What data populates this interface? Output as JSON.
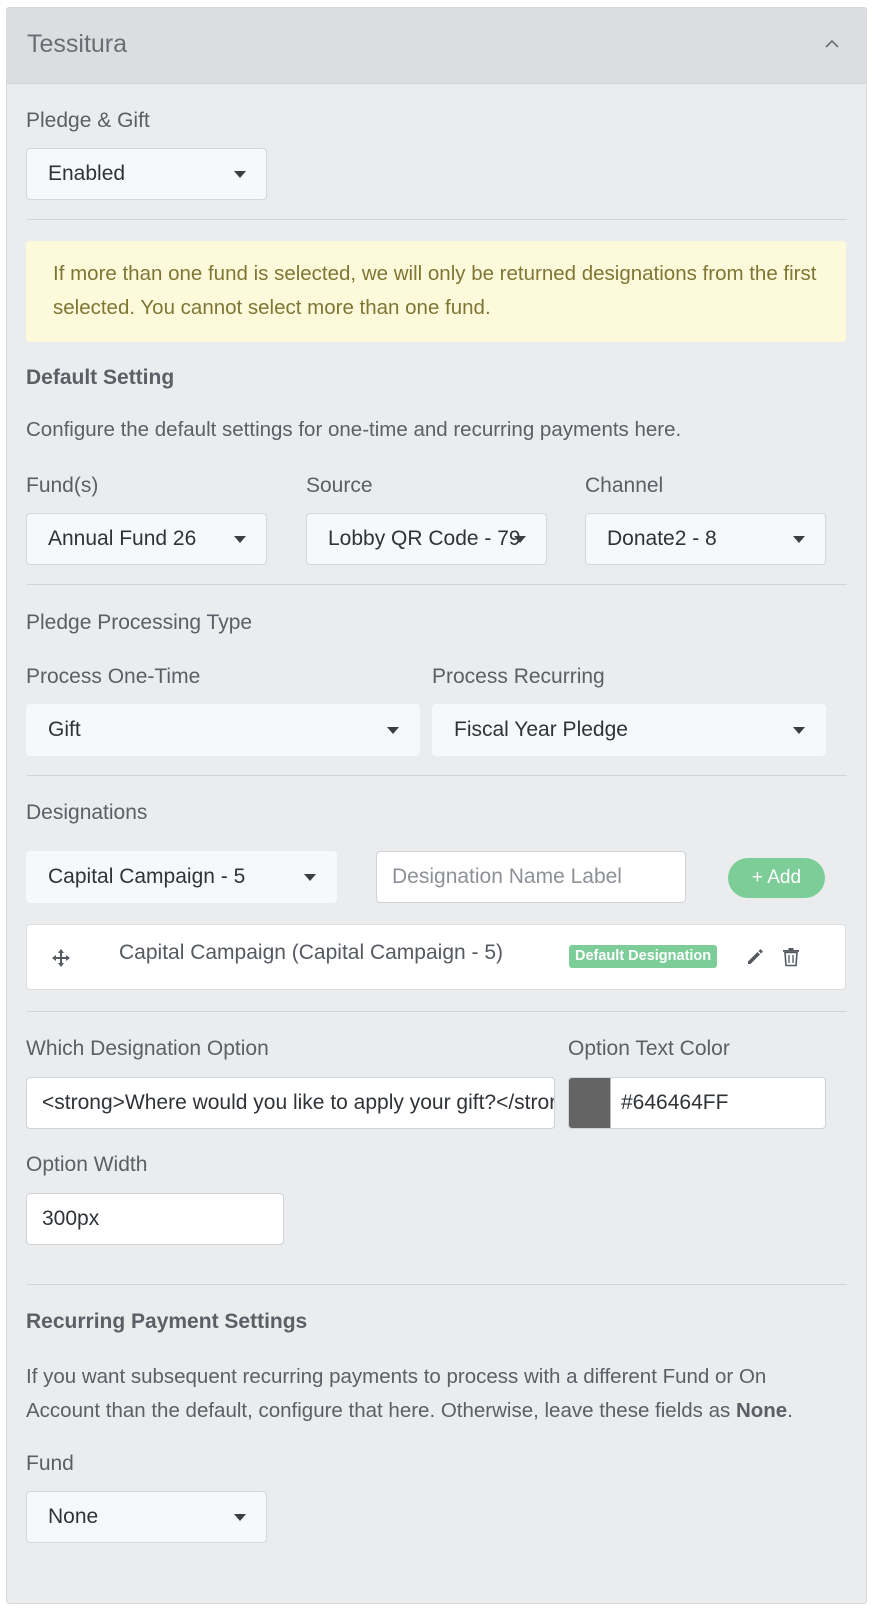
{
  "panel": {
    "title": "Tessitura"
  },
  "pledge_gift": {
    "label": "Pledge & Gift",
    "value": "Enabled"
  },
  "alert": {
    "text": "If more than one fund is selected, we will only be returned designations from the first selected. You cannot select more than one fund."
  },
  "default_setting": {
    "heading": "Default Setting",
    "description": "Configure the default settings for one-time and recurring payments here.",
    "funds": {
      "label": "Fund(s)",
      "value": "Annual Fund 26"
    },
    "source": {
      "label": "Source",
      "value": "Lobby QR Code - 79"
    },
    "channel": {
      "label": "Channel",
      "value": "Donate2 - 8"
    }
  },
  "pledge_processing": {
    "heading": "Pledge Processing Type",
    "one_time": {
      "label": "Process One-Time",
      "value": "Gift"
    },
    "recurring": {
      "label": "Process Recurring",
      "value": "Fiscal Year Pledge"
    }
  },
  "designations": {
    "heading": "Designations",
    "select_value": "Capital Campaign - 5",
    "name_placeholder": "Designation Name Label",
    "add_label": "+ Add",
    "items": [
      {
        "name": "Capital Campaign (Capital Campaign - 5)",
        "badge": "Default Designation"
      }
    ]
  },
  "designation_option": {
    "label": "Which Designation Option",
    "value": "<strong>Where would you like to apply your gift?</strong>"
  },
  "option_text_color": {
    "label": "Option Text Color",
    "value": "#646464FF",
    "swatch": "#646464"
  },
  "option_width": {
    "label": "Option Width",
    "value": "300px"
  },
  "recurring_settings": {
    "heading": "Recurring Payment Settings",
    "description_pre": "If you want subsequent recurring payments to process with a different Fund or On Account than the default, configure that here. Otherwise, leave these fields as ",
    "description_bold": "None",
    "description_post": ".",
    "fund": {
      "label": "Fund",
      "value": "None"
    }
  }
}
